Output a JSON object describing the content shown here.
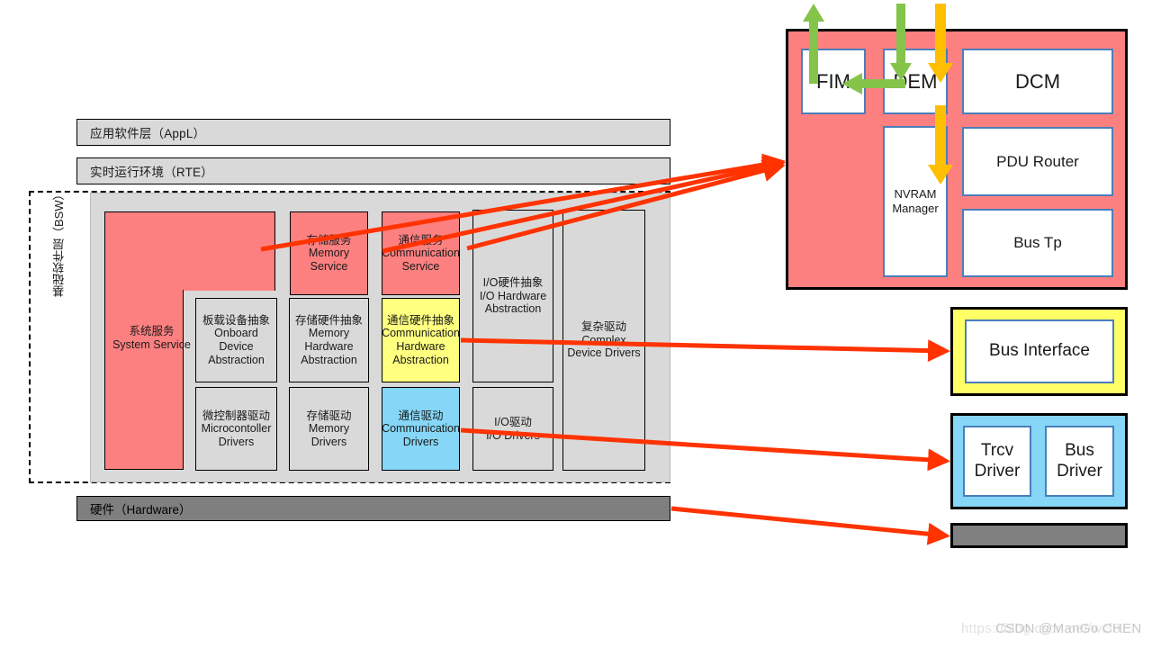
{
  "left_stack": {
    "appl": "应用软件层（AppL）",
    "rte": "实时运行环境（RTE）",
    "bsw_side_label": "基础软件层（BSW）",
    "hardware": "硬件（Hardware）",
    "cells": {
      "system_service": {
        "zh": "系统服务",
        "en": "System Service"
      },
      "memory_service": {
        "zh": "存储服务",
        "en": "Memory Service"
      },
      "comm_service": {
        "zh": "通信服务",
        "en": "Communication Service"
      },
      "io_hw_abs": {
        "zh": "I/O硬件抽象",
        "en": "I/O Hardware Abstraction"
      },
      "complex_drivers": {
        "zh": "复杂驱动",
        "en": "Complex Device Drivers"
      },
      "onboard_dev_abs": {
        "zh": "板载设备抽象",
        "en": "Onboard Device Abstraction"
      },
      "memory_hw_abs": {
        "zh": "存储硬件抽象",
        "en": "Memory Hardware Abstraction"
      },
      "comm_hw_abs": {
        "zh": "通信硬件抽象",
        "en": "Communication Hardware Abstraction"
      },
      "mcu_drivers": {
        "zh": "微控制器驱动",
        "en": "Microcontoller Drivers"
      },
      "memory_drivers": {
        "zh": "存储驱动",
        "en": "Memory Drivers"
      },
      "comm_drivers": {
        "zh": "通信驱动",
        "en": "Communication Drivers"
      },
      "io_drivers": {
        "zh": "I/O驱动",
        "en": "I/O Drivers"
      }
    }
  },
  "right_panels": {
    "services_panel": {
      "fim": "FIM",
      "dem": "DEM",
      "dcm": "DCM",
      "nvram_manager": "NVRAM Manager",
      "pdu_router": "PDU Router",
      "bus_tp": "Bus Tp"
    },
    "bus_interface_panel": {
      "label": "Bus Interface"
    },
    "drivers_panel": {
      "trcv_driver": "Trcv Driver",
      "bus_driver": "Bus Driver"
    },
    "hardware_panel": {
      "label": ""
    }
  },
  "colors": {
    "red_fill": "#fd8080",
    "yellow_fill": "#ffff80",
    "cyan_fill": "#85d6f7",
    "grey_fill": "#d9d9d9",
    "hardware_grey": "#7f7f7f",
    "box_blue_border": "#4a7ebb",
    "arrow_red": "#ff3300",
    "arrow_green": "#84c44a",
    "arrow_orange": "#ffbf00"
  },
  "arrows": {
    "red_connectors": 5,
    "green_up": "green-up-arrow",
    "green_down": "green-down-arrow",
    "green_left": "green-left-arrow",
    "orange_down_upper": "orange-down-arrow-upper",
    "orange_down_lower": "orange-down-arrow-lower"
  },
  "watermark": {
    "url": "https://blog.csdn.net/wcf8.",
    "text": "CSDN @ManGo CHEN"
  }
}
